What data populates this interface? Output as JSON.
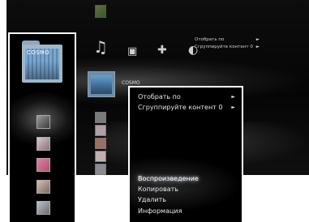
{
  "folder": {
    "name": "COSMO"
  },
  "mid_label": "COSMO",
  "mini_menu": {
    "items": [
      {
        "label": "Отобрать по",
        "arrow": "►"
      },
      {
        "label": "Сгруппируйте контент  0",
        "arrow": "►"
      }
    ]
  },
  "context_menu": {
    "top_items": [
      {
        "label": "Отобрать по",
        "arrow": "►"
      },
      {
        "label": "Сгруппируйте контент  0",
        "arrow": "►"
      }
    ],
    "actions": [
      {
        "label": "Воспроизведение",
        "selected": true
      },
      {
        "label": "Копировать",
        "selected": false
      },
      {
        "label": "Удалить",
        "selected": false
      },
      {
        "label": "Информация",
        "selected": false
      }
    ]
  },
  "icons": {
    "music": "music-icon",
    "video": "video-icon",
    "game": "game-icon",
    "network": "network-icon"
  },
  "colors": {
    "panel_border": "#ffffff",
    "background": "#000000",
    "text": "#e6e6e6"
  }
}
